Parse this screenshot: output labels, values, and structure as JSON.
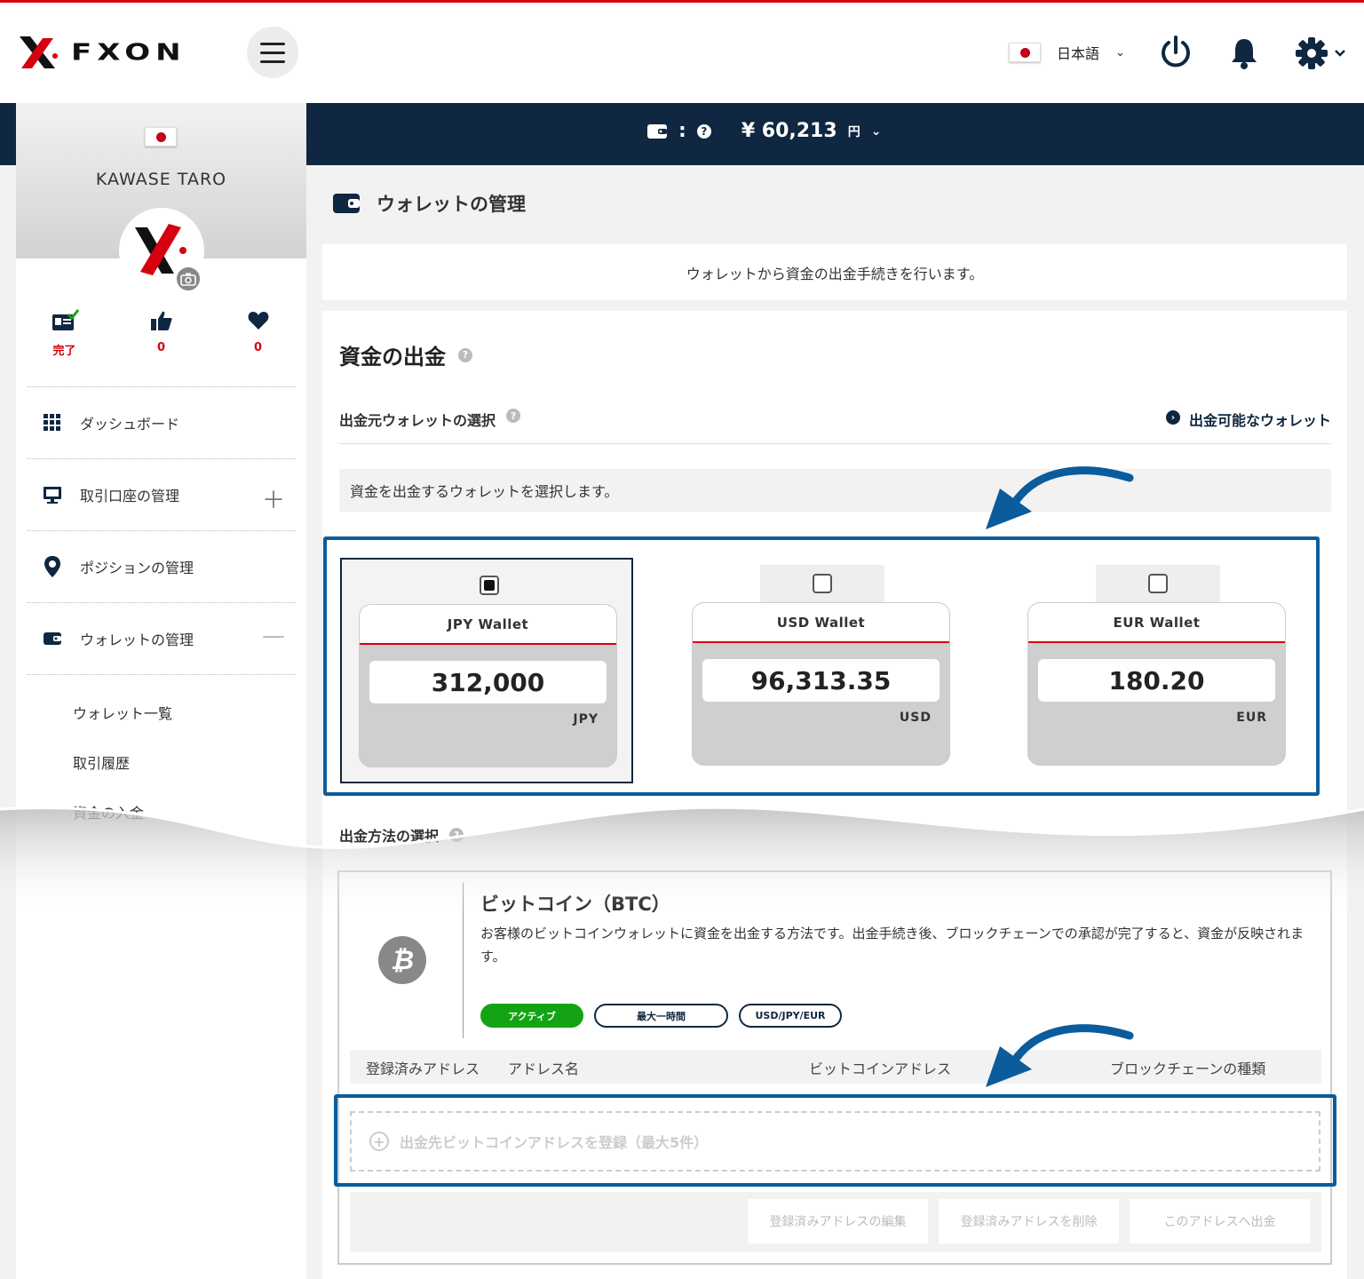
{
  "header": {
    "logo_text": "FXON",
    "language": "日本語",
    "colors": {
      "brand_red": "#d7000f",
      "navy": "#0f2740",
      "frame_blue": "#0a5c9c"
    }
  },
  "balance": {
    "label_sep": ":",
    "amount": "¥ 60,213",
    "unit": "円"
  },
  "sidebar": {
    "user_name": "KAWASE TARO",
    "stats": [
      {
        "icon": "id-card-check-icon",
        "value": "完了"
      },
      {
        "icon": "thumbs-up-icon",
        "value": "0"
      },
      {
        "icon": "heart-icon",
        "value": "0"
      }
    ],
    "nav": [
      {
        "label": "ダッシュボード",
        "icon": "grid-icon"
      },
      {
        "label": "取引口座の管理",
        "icon": "monitor-icon",
        "toggle": "＋"
      },
      {
        "label": "ポジションの管理",
        "icon": "map-pin-icon"
      },
      {
        "label": "ウォレットの管理",
        "icon": "wallet-icon",
        "toggle": "—"
      }
    ],
    "subnav": [
      "ウォレット一覧",
      "取引履歴",
      "資金の入金"
    ]
  },
  "main": {
    "page_title": "ウォレットの管理",
    "intro": "ウォレットから資金の出金手続きを行います。",
    "section_title": "資金の出金",
    "source_select_title": "出金元ウォレットの選択",
    "available_wallets_link": "出金可能なウォレット",
    "source_hint": "資金を出金するウォレットを選択します。",
    "wallets": [
      {
        "name": "JPY Wallet",
        "amount": "312,000",
        "currency": "JPY",
        "selected": true
      },
      {
        "name": "USD Wallet",
        "amount": "96,313.35",
        "currency": "USD",
        "selected": false
      },
      {
        "name": "EUR Wallet",
        "amount": "180.20",
        "currency": "EUR",
        "selected": false
      }
    ],
    "method_title": "出金方法の選択",
    "method": {
      "icon_glyph": "₿",
      "title": "ビットコイン（BTC）",
      "description": "お客様のビットコインウォレットに資金を出金する方法です。出金手続き後、ブロックチェーンでの承認が完了すると、資金が反映されます。",
      "tags": [
        "アクティブ",
        "最大一時間",
        "USD/JPY/EUR"
      ],
      "address_columns": [
        "登録済みアドレス",
        "アドレス名",
        "ビットコインアドレス",
        "ブロックチェーンの種類"
      ],
      "add_address": "出金先ビットコインアドレスを登録（最大5件）",
      "actions": [
        "登録済みアドレスの編集",
        "登録済みアドレスを削除",
        "このアドレスへ出金"
      ]
    }
  }
}
